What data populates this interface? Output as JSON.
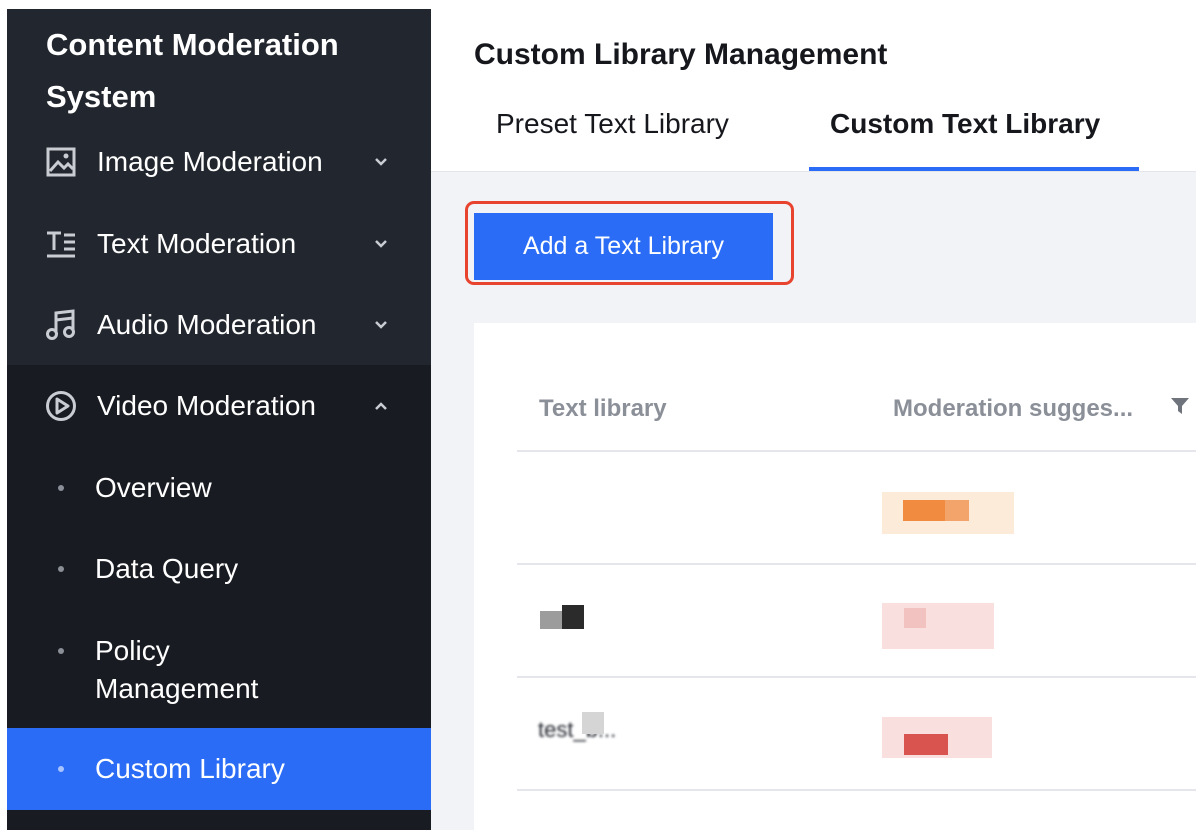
{
  "sidebar": {
    "brand_line1": "Content Moderation",
    "brand_line2": "System",
    "items": [
      {
        "label": "Image Moderation",
        "icon": "image-icon",
        "expanded": false
      },
      {
        "label": "Text Moderation",
        "icon": "text-icon",
        "expanded": false
      },
      {
        "label": "Audio Moderation",
        "icon": "music-note-icon",
        "expanded": false
      },
      {
        "label": "Video Moderation",
        "icon": "play-circle-icon",
        "expanded": true
      }
    ],
    "subitems": [
      {
        "label": "Overview",
        "active": false
      },
      {
        "label": "Data Query",
        "active": false
      },
      {
        "label": "Policy Management",
        "active": false
      },
      {
        "label": "Custom Library",
        "active": true
      }
    ]
  },
  "main": {
    "title": "Custom Library Management",
    "tabs": [
      {
        "label": "Preset Text Library",
        "active": false
      },
      {
        "label": "Custom Text Library",
        "active": true
      }
    ],
    "add_button_label": "Add a Text Library",
    "table": {
      "columns": [
        "Text library",
        "Moderation sugges..."
      ],
      "rows": [
        {
          "library": "",
          "suggestion": ""
        },
        {
          "library": "",
          "suggestion": ""
        },
        {
          "library": "test_b...",
          "suggestion": ""
        }
      ]
    }
  },
  "colors": {
    "sidebar_bg": "#22262e",
    "submenu_bg": "#181b21",
    "accent": "#2a6cf6",
    "highlight_outline": "#e8432f",
    "content_bg": "#f2f3f7"
  }
}
